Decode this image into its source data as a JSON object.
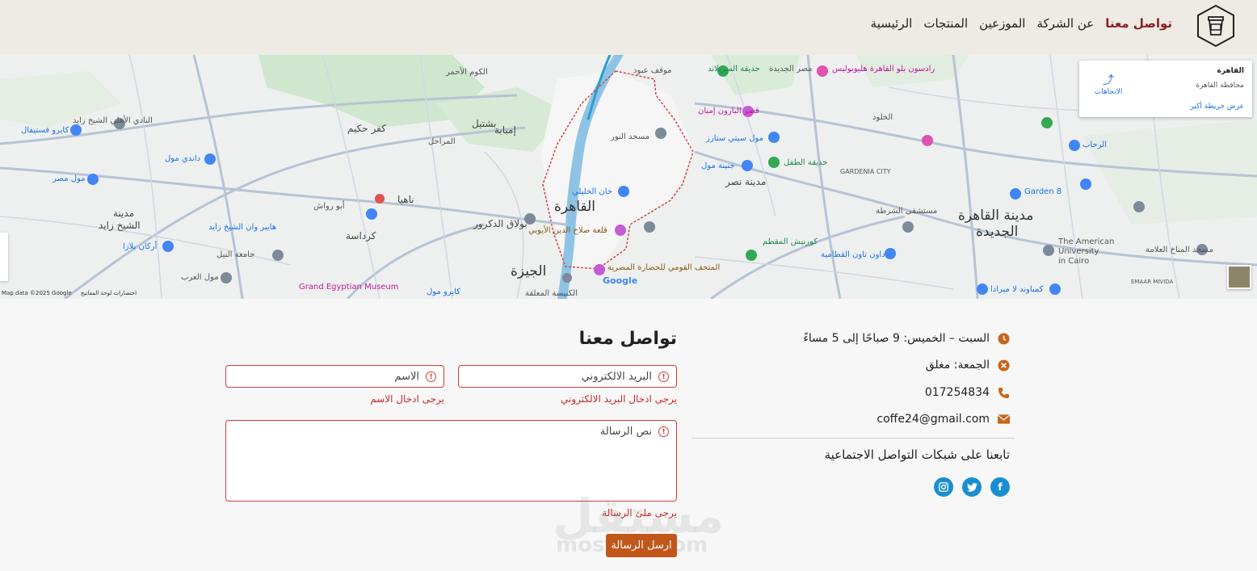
{
  "header": {
    "nav": [
      {
        "label": "الرئيسية",
        "active": false
      },
      {
        "label": "المنتجات",
        "active": false
      },
      {
        "label": "الموزعين",
        "active": false
      },
      {
        "label": "عن الشركة",
        "active": false
      },
      {
        "label": "تواصل معنا",
        "active": true
      }
    ],
    "active_color": "#8b1f25"
  },
  "map": {
    "card_title": "القاهرة",
    "card_subtitle": "محافظة القاهرة",
    "directions_label": "الاتجاهات",
    "bigger_map_label": "عرض خريطة أكبر",
    "attribution": "Map data ©2025 Google",
    "shortcuts": "اختصارات لوحة المفاتيح",
    "google": "Google",
    "labels": {
      "cairo": "القاهرة",
      "giza": "الجيزة",
      "new_cairo_1": "مدينة القاهرة",
      "new_cairo_2": "الجديدة",
      "sheikh_zayed_1": "مدينة",
      "sheikh_zayed_2": "الشيخ زايد",
      "nasr_city": "مدينة نصر",
      "gardenia": "GARDENIA CITY",
      "gem": "Grand Egyptian Museum",
      "auc_1": "The American",
      "auc_2": "University",
      "auc_3": "in Cairo",
      "emaar": "EMAAR MIVIDA",
      "khan": "خان الخليلي",
      "citadel": "قلعة صلاح الدين الأيوبي",
      "imbaba": "إمبابة",
      "boulaq": "بولاق الدكرور",
      "kerdasa": "كرداسة",
      "nahia": "ناهيا",
      "abu_rawash": "أبو رواش",
      "kafr_hakim": "كفر حكيم",
      "bashtil": "بشتيل",
      "marazeq": "المراحل",
      "kom_ahmar": "الكوم الأحمر",
      "mall_arabia": "مول العرب",
      "mall_masr": "مول مصر",
      "dandy": "داندي مول",
      "cairo_festival": "كايرو فستيفال",
      "city_stars": "مول سيتي ستارز",
      "rehab": "الرحاب",
      "heliopolis": "رادسون بلو القاهرة هليوبوليس",
      "baron": "قصر البارون إمبان",
      "merryland": "حديقة الميريلاند",
      "masr_gedida": "مصر الجديدة",
      "obour": "موقف عبود",
      "noor": "مسجد النور",
      "sayeda": "المتحف القومي للحضارة المصرية",
      "sheikh_zayed_club": "النادي الأهلي الشيخ زايد",
      "waterway": "مستشفى الشرطة",
      "mokattam": "كورنيش المقطم",
      "downtown_mall": "داون تاون القطامية",
      "kempinski": "كمباوند لا ميرادا",
      "child_park": "حديقة الطفل",
      "genena": "جنينة مول",
      "arkan": "أركان بلازا",
      "hyper": "هايبر وان الشيخ زايد",
      "nile_uni": "جامعة النيل",
      "garden8": "Garden 8",
      "kholood": "الخلود",
      "mostashfa": "مسجد المناخ العلامة",
      "kairo_mall": "كايرو مول",
      "kanisa": "الكنيسة المعلقة"
    }
  },
  "contact_info": {
    "hours_weekdays": "السبت – الخميس: 9 صباحًا إلى 5 مساءً",
    "hours_friday": "الجمعة: مغلق",
    "phone": "017254834",
    "email": "coffe24@gmail.com",
    "follow_title": "تابعنا على شبكات التواصل الاجتماعية",
    "social": [
      "facebook-icon",
      "twitter-icon",
      "instagram-icon"
    ],
    "icon_color": "#c8651a",
    "social_color": "#1a8fd0"
  },
  "form": {
    "title": "تواصل معنا",
    "email_placeholder": "البريد الالكتروني",
    "name_placeholder": "الاسم",
    "message_placeholder": "نص الرسالة",
    "email_error": "يرجى ادخال البريد الالكتروني",
    "name_error": "يرجى ادخال الاسم",
    "message_error": "يرجى ملئ الرسالة",
    "submit_label": "ارسل الرسالة",
    "error_color": "#c62828",
    "button_color": "#c2571b"
  },
  "watermark": {
    "ar": "مستقل",
    "en": "mostaql.com"
  }
}
